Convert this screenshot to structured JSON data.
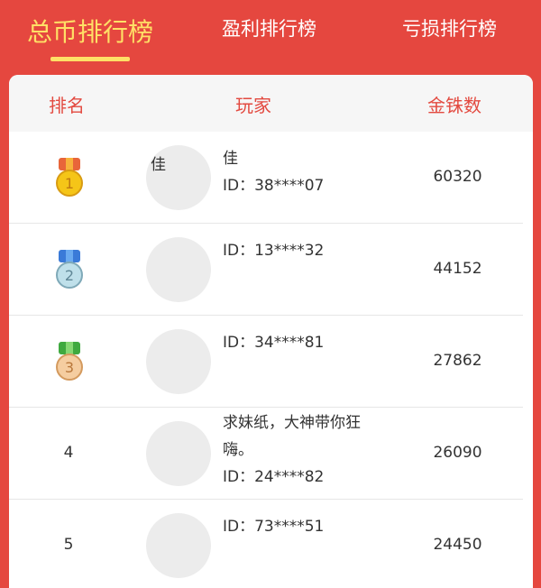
{
  "tabs": [
    {
      "label": "总币排行榜",
      "active": true
    },
    {
      "label": "盈利排行榜",
      "active": false
    },
    {
      "label": "亏损排行榜",
      "active": false
    }
  ],
  "table": {
    "headers": {
      "rank": "排名",
      "player": "玩家",
      "score": "金铢数"
    },
    "rows": [
      {
        "rank": "1",
        "medal": "gold-medal-icon",
        "avatar_char": "佳",
        "name": "佳",
        "id": "ID：38****07",
        "score": "60320"
      },
      {
        "rank": "2",
        "medal": "silver-medal-icon",
        "avatar_char": "",
        "name": "",
        "id": "ID：13****32",
        "score": "44152"
      },
      {
        "rank": "3",
        "medal": "bronze-medal-icon",
        "avatar_char": "",
        "name": "",
        "id": "ID：34****81",
        "score": "27862"
      },
      {
        "rank": "4",
        "medal": "",
        "avatar_char": "",
        "name_line1": "求妹纸，大神带你狂",
        "name_line2": "嗨。",
        "id": "ID：24****82",
        "score": "26090"
      },
      {
        "rank": "5",
        "medal": "",
        "avatar_char": "",
        "name": "",
        "id": "ID：73****51",
        "score": "24450"
      }
    ]
  },
  "colors": {
    "brand_red": "#e5473f",
    "tab_active": "#ffe066",
    "header_text": "#e34a40",
    "gold": "#f5c518",
    "silver": "#bfe0ea",
    "bronze": "#f5cda0"
  }
}
